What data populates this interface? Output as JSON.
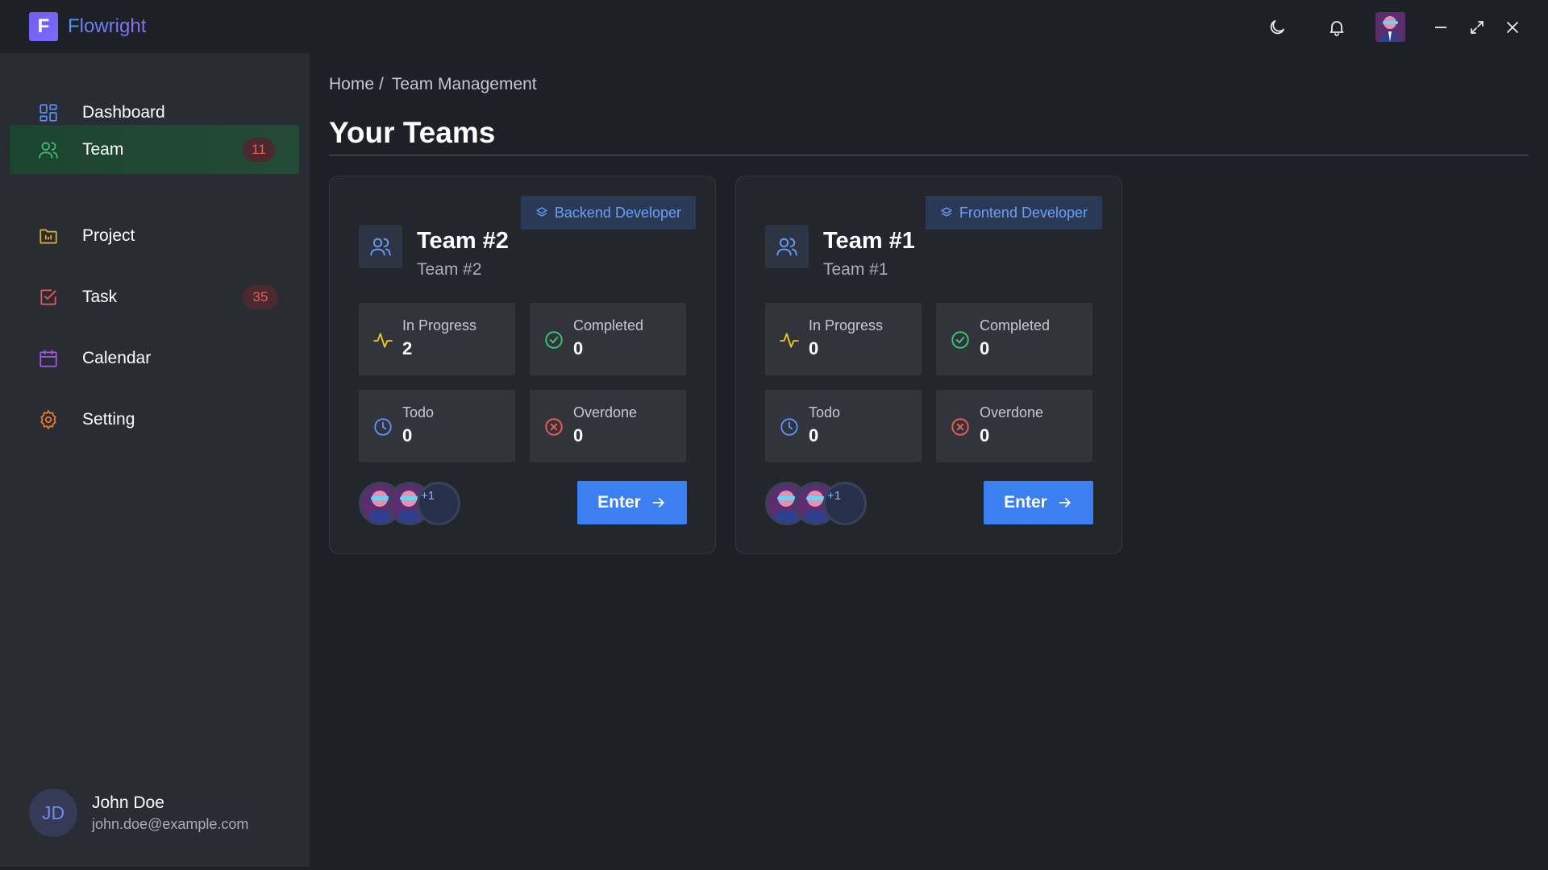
{
  "app": {
    "name": "Flowright",
    "logo_letter": "F"
  },
  "titlebar": {
    "icons": [
      "moon-icon",
      "bell-icon",
      "user-avatar",
      "minimize-icon",
      "maximize-icon",
      "close-icon"
    ]
  },
  "sidebar": {
    "items": [
      {
        "label": "Dashboard",
        "icon": "dashboard-icon",
        "icon_color": "#5b8ef7",
        "badge": "",
        "active": false
      },
      {
        "label": "Team",
        "icon": "users-icon",
        "icon_color": "#3fc07a",
        "badge": "11",
        "active": true
      },
      {
        "label": "Project",
        "icon": "folder-chart-icon",
        "icon_color": "#e6b422",
        "badge": "",
        "active": false
      },
      {
        "label": "Task",
        "icon": "checkbox-icon",
        "icon_color": "#ee5a5a",
        "badge": "35",
        "active": false
      },
      {
        "label": "Calendar",
        "icon": "calendar-icon",
        "icon_color": "#a25ae6",
        "badge": "",
        "active": false
      },
      {
        "label": "Setting",
        "icon": "gear-icon",
        "icon_color": "#f07c2a",
        "badge": "",
        "active": false
      }
    ],
    "user": {
      "initials": "JD",
      "name": "John Doe",
      "email": "john.doe@example.com"
    }
  },
  "breadcrumb": {
    "home": "Home",
    "separator": "/",
    "current": "Team Management"
  },
  "page": {
    "title": "Your Teams"
  },
  "teams": [
    {
      "role": "Backend Developer",
      "name": "Team #2",
      "subtitle": "Team #2",
      "stats": {
        "in_progress": {
          "label": "In Progress",
          "value": "2"
        },
        "completed": {
          "label": "Completed",
          "value": "0"
        },
        "todo": {
          "label": "Todo",
          "value": "0"
        },
        "overdone": {
          "label": "Overdone",
          "value": "0"
        }
      },
      "extra_members": "+1",
      "enter_label": "Enter"
    },
    {
      "role": "Frontend Developer",
      "name": "Team #1",
      "subtitle": "Team #1",
      "stats": {
        "in_progress": {
          "label": "In Progress",
          "value": "0"
        },
        "completed": {
          "label": "Completed",
          "value": "0"
        },
        "todo": {
          "label": "Todo",
          "value": "0"
        },
        "overdone": {
          "label": "Overdone",
          "value": "0"
        }
      },
      "extra_members": "+1",
      "enter_label": "Enter"
    }
  ],
  "colors": {
    "accent": "#3b7ff0",
    "success": "#3fc07a",
    "warning": "#e6b422",
    "danger": "#ee5a5a",
    "info": "#5b8ef7"
  }
}
